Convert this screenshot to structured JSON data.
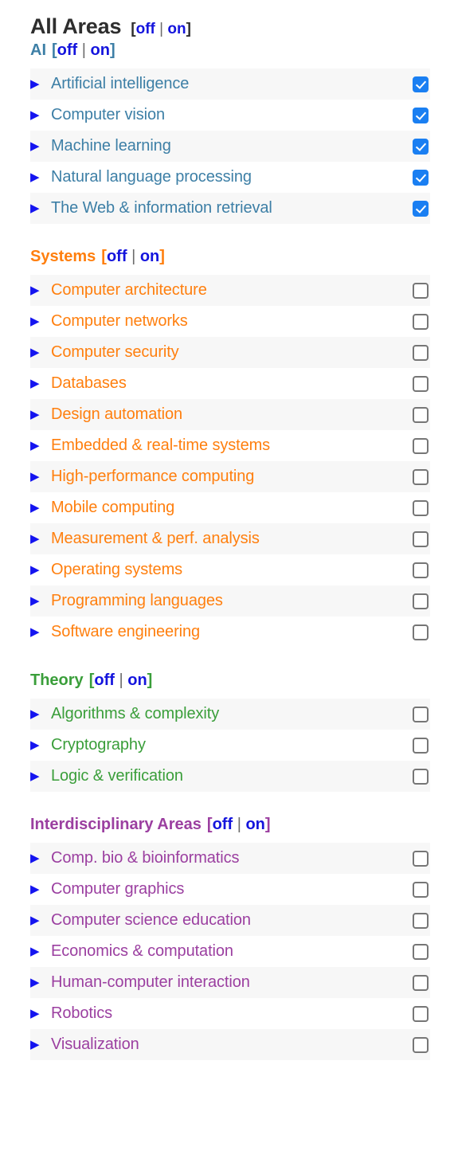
{
  "header": {
    "title": "All Areas",
    "toggle": {
      "open_bracket": "[",
      "off": "off",
      "separator": "|",
      "on": "on",
      "close_bracket": "]"
    }
  },
  "toggle_labels": {
    "open_bracket": "[",
    "off": "off",
    "separator": "|",
    "on": "on",
    "close_bracket": "]"
  },
  "icons": {
    "expander": "▶"
  },
  "colors": {
    "ai": "#3d7fa6",
    "systems": "#ff7f0e",
    "theory": "#3a9e3a",
    "interdisciplinary": "#9b3fa0",
    "link": "#1414dd",
    "triangle": "#1414f0",
    "checkbox_checked": "#1a7ff2",
    "checkbox_border": "#767676",
    "row_stripe": "#f7f7f7",
    "title": "#2e2e2e"
  },
  "sections": [
    {
      "id": "ai",
      "title": "AI",
      "items": [
        {
          "label": "Artificial intelligence",
          "checked": true
        },
        {
          "label": "Computer vision",
          "checked": true
        },
        {
          "label": "Machine learning",
          "checked": true
        },
        {
          "label": "Natural language processing",
          "checked": true
        },
        {
          "label": "The Web & information retrieval",
          "checked": true
        }
      ]
    },
    {
      "id": "systems",
      "title": "Systems",
      "items": [
        {
          "label": "Computer architecture",
          "checked": false
        },
        {
          "label": "Computer networks",
          "checked": false
        },
        {
          "label": "Computer security",
          "checked": false
        },
        {
          "label": "Databases",
          "checked": false
        },
        {
          "label": "Design automation",
          "checked": false
        },
        {
          "label": "Embedded & real-time systems",
          "checked": false
        },
        {
          "label": "High-performance computing",
          "checked": false
        },
        {
          "label": "Mobile computing",
          "checked": false
        },
        {
          "label": "Measurement & perf. analysis",
          "checked": false
        },
        {
          "label": "Operating systems",
          "checked": false
        },
        {
          "label": "Programming languages",
          "checked": false
        },
        {
          "label": "Software engineering",
          "checked": false
        }
      ]
    },
    {
      "id": "theory",
      "title": "Theory",
      "items": [
        {
          "label": "Algorithms & complexity",
          "checked": false
        },
        {
          "label": "Cryptography",
          "checked": false
        },
        {
          "label": "Logic & verification",
          "checked": false
        }
      ]
    },
    {
      "id": "interdisciplinary",
      "title": "Interdisciplinary Areas",
      "items": [
        {
          "label": "Comp. bio & bioinformatics",
          "checked": false
        },
        {
          "label": "Computer graphics",
          "checked": false
        },
        {
          "label": "Computer science education",
          "checked": false
        },
        {
          "label": "Economics & computation",
          "checked": false
        },
        {
          "label": "Human-computer interaction",
          "checked": false
        },
        {
          "label": "Robotics",
          "checked": false
        },
        {
          "label": "Visualization",
          "checked": false
        }
      ]
    }
  ]
}
